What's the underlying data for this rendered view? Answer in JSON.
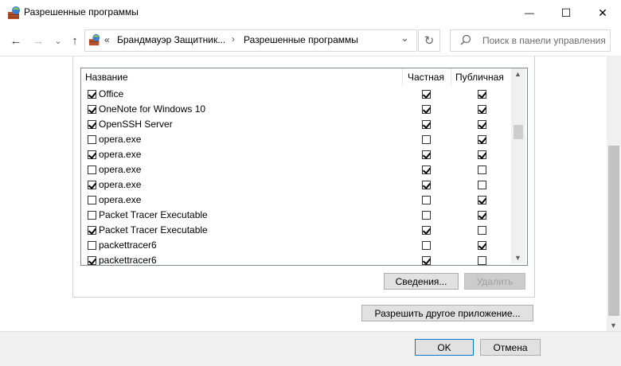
{
  "window": {
    "title": "Разрешенные программы",
    "minimize_glyph": "—",
    "maximize_glyph": "☐",
    "close_glyph": "✕"
  },
  "nav": {
    "back_glyph": "←",
    "forward_glyph": "→",
    "recent_glyph": "⌄",
    "up_glyph": "↑",
    "breadcrumb_overflow": "«",
    "breadcrumb": [
      "Брандмауэр Защитник...",
      "Разрешенные программы"
    ],
    "breadcrumb_sep": "›",
    "dropdown_glyph": "⌄",
    "refresh_glyph": "↻",
    "search_placeholder": "Поиск в панели управления"
  },
  "grid": {
    "columns": {
      "name": "Название",
      "private": "Частная",
      "public": "Публичная"
    },
    "rows": [
      {
        "name": "Office",
        "enabled": true,
        "private": true,
        "public": true
      },
      {
        "name": "OneNote for Windows 10",
        "enabled": true,
        "private": true,
        "public": true
      },
      {
        "name": "OpenSSH Server",
        "enabled": true,
        "private": true,
        "public": true
      },
      {
        "name": "opera.exe",
        "enabled": false,
        "private": false,
        "public": true
      },
      {
        "name": "opera.exe",
        "enabled": true,
        "private": true,
        "public": true
      },
      {
        "name": "opera.exe",
        "enabled": false,
        "private": true,
        "public": false
      },
      {
        "name": "opera.exe",
        "enabled": true,
        "private": true,
        "public": false
      },
      {
        "name": "opera.exe",
        "enabled": false,
        "private": false,
        "public": true
      },
      {
        "name": "Packet Tracer Executable",
        "enabled": false,
        "private": false,
        "public": true
      },
      {
        "name": "Packet Tracer Executable",
        "enabled": true,
        "private": true,
        "public": false
      },
      {
        "name": "packettracer6",
        "enabled": false,
        "private": false,
        "public": true
      },
      {
        "name": "packettracer6",
        "enabled": true,
        "private": true,
        "public": false
      }
    ]
  },
  "buttons": {
    "details": "Сведения...",
    "remove": "Удалить",
    "allow_other": "Разрешить другое приложение...",
    "ok": "OK",
    "cancel": "Отмена"
  },
  "colors": {
    "scrollbar_track": "#f0f0f0",
    "scrollbar_thumb": "#cdcdcd",
    "button_face": "#e1e1e1"
  }
}
